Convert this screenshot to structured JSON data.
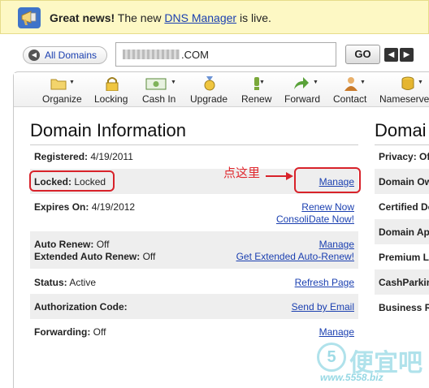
{
  "notice": {
    "headline": "Great news!",
    "text_before": " The new ",
    "link": "DNS Manager",
    "text_after": " is live.",
    "icon": "megaphone-icon"
  },
  "nav": {
    "all_domains": "All Domains",
    "domain_suffix": ".COM",
    "go": "GO",
    "prev_icon": "arrow-left-icon",
    "next_icon": "arrow-right-icon"
  },
  "toolbar": {
    "items": [
      {
        "label": "Organize",
        "icon": "folder-icon"
      },
      {
        "label": "Locking",
        "icon": "lock-icon"
      },
      {
        "label": "Cash In",
        "icon": "cash-icon"
      },
      {
        "label": "Upgrade",
        "icon": "medal-icon"
      },
      {
        "label": "Renew",
        "icon": "renew-icon"
      },
      {
        "label": "Forward",
        "icon": "forward-arrow-icon"
      },
      {
        "label": "Contact",
        "icon": "contact-person-icon"
      },
      {
        "label": "Nameserve",
        "icon": "database-icon"
      }
    ]
  },
  "domain_info": {
    "title": "Domain Information",
    "registered_label": "Registered:",
    "registered_value": "4/19/2011",
    "locked_label": "Locked:",
    "locked_value": "Locked",
    "locked_action": "Manage",
    "expires_label": "Expires On:",
    "expires_value": "4/19/2012",
    "renew_now": "Renew Now",
    "consolidate_now": "ConsoliDate Now!",
    "auto_renew_label": "Auto Renew:",
    "auto_renew_value": "Off",
    "auto_renew_action": "Manage",
    "ext_auto_renew_label": "Extended Auto Renew:",
    "ext_auto_renew_value": "Off",
    "ext_auto_renew_action": "Get Extended Auto-Renew!",
    "status_label": "Status:",
    "status_value": "Active",
    "refresh_page": "Refresh Page",
    "auth_code_label": "Authorization Code:",
    "send_by_email": "Send by Email",
    "forwarding_label": "Forwarding:",
    "forwarding_value": "Off",
    "forwarding_action": "Manage"
  },
  "right_col": {
    "title": "Domai",
    "rows": [
      "Privacy: Of",
      "Domain Ow",
      "Certified Do",
      "Domain Ap",
      "Premium L",
      "CashParkin",
      "Business R"
    ]
  },
  "annotation": {
    "note": "点这里",
    "color": "#e0282e"
  },
  "watermark": {
    "badge": "5",
    "name": "便宜吧",
    "url": "www.5558.biz"
  }
}
